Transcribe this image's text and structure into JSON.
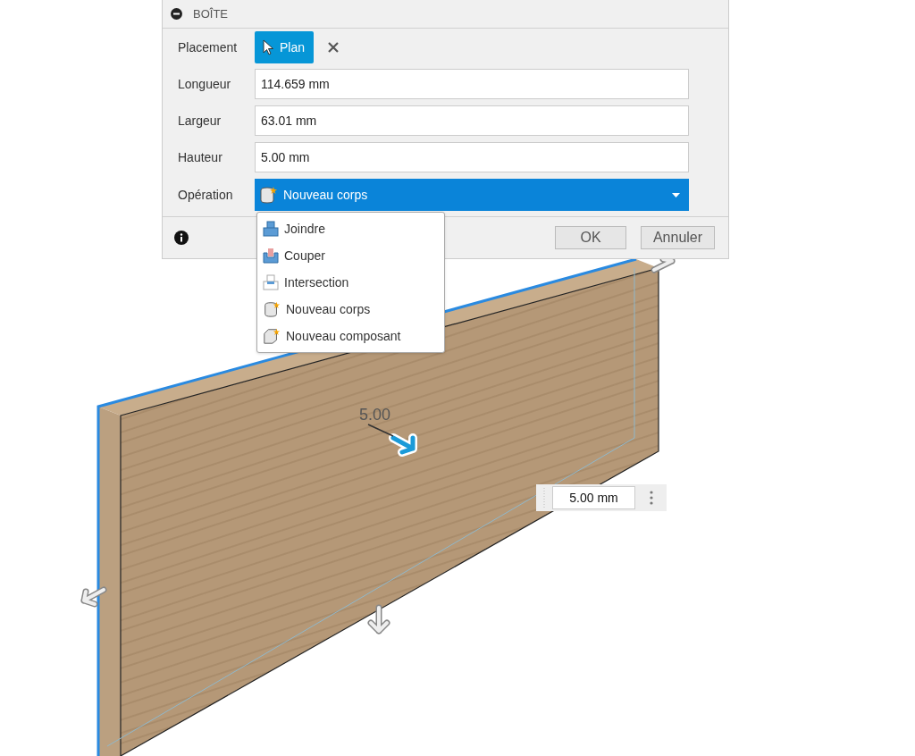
{
  "dialog": {
    "title": "BOÎTE",
    "placement": {
      "label": "Placement",
      "button": "Plan"
    },
    "fields": [
      {
        "label": "Longueur",
        "value": "114.659 mm"
      },
      {
        "label": "Largeur",
        "value": "63.01 mm"
      },
      {
        "label": "Hauteur",
        "value": "5.00 mm"
      }
    ],
    "operation": {
      "label": "Opération",
      "value": "Nouveau corps",
      "kind": "new-body",
      "expanded": true,
      "options": [
        {
          "label": "Joindre",
          "kind": "join"
        },
        {
          "label": "Couper",
          "kind": "cut"
        },
        {
          "label": "Intersection",
          "kind": "intersect"
        },
        {
          "label": "Nouveau corps",
          "kind": "new-body"
        },
        {
          "label": "Nouveau composant",
          "kind": "new-component"
        }
      ]
    },
    "buttons": [
      "OK",
      "Annuler"
    ]
  },
  "viewport": {
    "dimension_label": "5.00",
    "dimension_input": "5.00 mm"
  }
}
